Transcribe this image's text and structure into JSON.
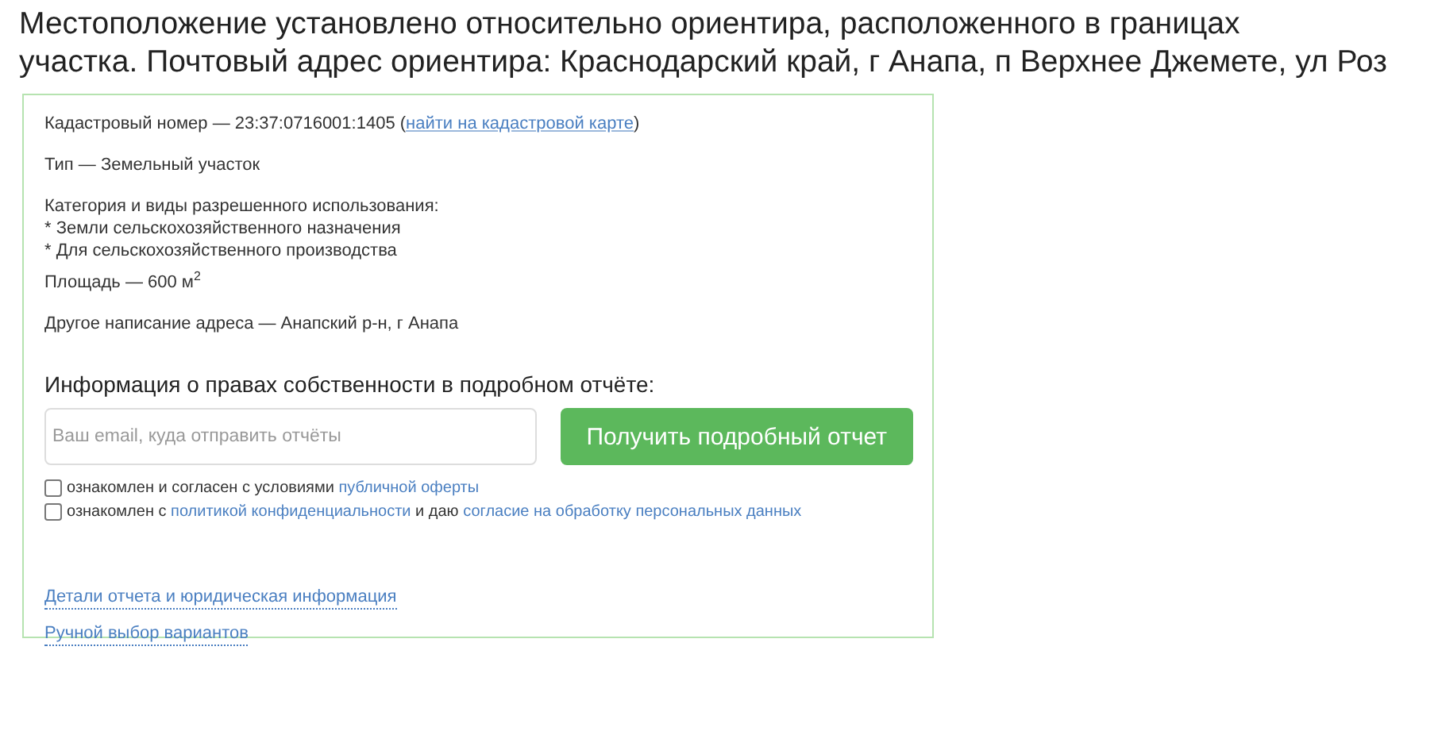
{
  "heading": {
    "lines": [
      "Местоположение установлено относительно ориентира, расположенного в границах",
      "участка. Почтовый адрес ориентира: Краснодарский край, г Анапа, п Верхнее Джемете, ул Роз"
    ]
  },
  "details": [
    {
      "parts": [
        {
          "kind": "text",
          "text": "Кадастровый номер — 23:37:0716001:1405 ("
        },
        {
          "kind": "link",
          "text": "найти на кадастровой карте"
        },
        {
          "kind": "text",
          "text": ")"
        }
      ]
    },
    {
      "parts": [
        {
          "kind": "text",
          "text": "Тип — Земельный участок"
        }
      ]
    },
    {
      "parts": [
        {
          "kind": "text",
          "text": "Категория и виды разрешенного использования:"
        },
        {
          "kind": "break"
        },
        {
          "kind": "text",
          "text": "* Земли сельскохозяйственного назначения"
        },
        {
          "kind": "break"
        },
        {
          "kind": "text",
          "text": "* Для сельскохозяйственного производства"
        }
      ]
    },
    {
      "parts": [
        {
          "kind": "text",
          "text": "Площадь — 600 м$^{2}$"
        }
      ]
    },
    {
      "parts": [
        {
          "kind": "text",
          "text": "Другое написание адреса — Анапский р-н, г Анапа"
        }
      ]
    }
  ],
  "order": {
    "title": "Информация о правах собственности в подробном отчёте:",
    "email": {
      "placeholder": "Ваш email, куда отправить отчёты"
    },
    "button": "Получить подробный отчет",
    "consents": [
      {
        "checked": false,
        "parts": [
          {
            "kind": "text",
            "text": "ознакомлен и согласен с условиями "
          },
          {
            "kind": "link",
            "text": "публичной оферты"
          }
        ]
      },
      {
        "checked": false,
        "parts": [
          {
            "kind": "text",
            "text": "ознакомлен с "
          },
          {
            "kind": "link",
            "text": "политикой конфиденциальности"
          },
          {
            "kind": "text",
            "text": " и даю "
          },
          {
            "kind": "link",
            "text": "согласие на обработку персональных данных"
          }
        ]
      }
    ]
  },
  "footer_links": [
    "Детали отчета и юридическая информация",
    "Ручной выбор вариантов"
  ]
}
